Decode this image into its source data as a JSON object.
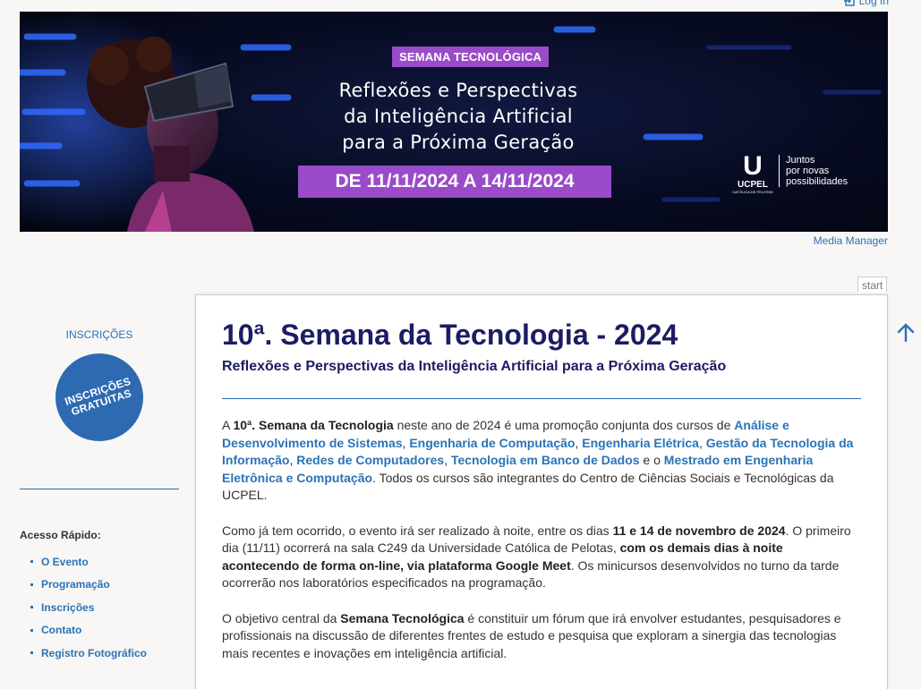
{
  "header": {
    "login_label": "Log In"
  },
  "banner": {
    "tag": "SEMANA TECNOLÓGICA",
    "headline_lines": [
      "Reflexões e Perspectivas",
      "da Inteligência Artificial",
      "para a Próxima Geração"
    ],
    "dates": "DE 11/11/2024 A 14/11/2024",
    "logo_letter": "U",
    "logo_name": "UCPEL",
    "logo_sub": "CATÓLICA DE PELOTAS",
    "slogan_lines": [
      "Juntos",
      "por novas",
      "possibilidades"
    ]
  },
  "media_manager_label": "Media Manager",
  "sidebar": {
    "inscricoes_heading": "INSCRIÇÕES",
    "badge_lines": [
      "INSCRIÇÕES",
      "GRATUITAS"
    ],
    "quick_access_title": "Acesso Rápido:",
    "quick_links": [
      "O Evento",
      "Programação",
      "Inscrições",
      "Contato",
      "Registro Fotográfico"
    ]
  },
  "start_tab_label": "start",
  "content": {
    "title": "10ª. Semana da Tecnologia - 2024",
    "subtitle": "Reflexões e Perspectivas da Inteligência Artificial para a Próxima Geração",
    "p1": {
      "t1": "A ",
      "b1": "10ª. Semana da Tecnologia",
      "t2": " neste ano de 2024 é uma promoção conjunta dos cursos de ",
      "l1": "Análise e Desenvolvimento de Sistemas",
      "t3": ", ",
      "l2": "Engenharia de Computação",
      "t4": ", ",
      "l3": "Engenharia Elétrica",
      "t5": ", ",
      "l4": "Gestão da Tecnologia da Informação",
      "t6": ", ",
      "l5": "Redes de Computadores",
      "t7": ", ",
      "l6": "Tecnologia em Banco de Dados",
      "t8": " e o ",
      "l7": "Mestrado em Engenharia Eletrônica e Computação",
      "t9": ". Todos os cursos são integrantes do Centro de Ciências Sociais e Tecnológicas da UCPEL."
    },
    "p2": {
      "t1": "Como já tem ocorrido, o evento irá ser realizado à noite, entre os dias ",
      "b1": "11 e 14 de novembro de 2024",
      "t2": ". O primeiro dia (11/11) ocorrerá na sala C249 da Universidade Católica de Pelotas, ",
      "b2": "com os demais dias à noite acontecendo de forma on-line, via plataforma Google Meet",
      "t3": ". Os minicursos desenvolvidos no turno da tarde ocorrerão nos laboratórios especificados na programação."
    },
    "p3": {
      "t1": "O objetivo central da ",
      "b1": "Semana Tecnológica",
      "t2": " é constituir um fórum que irá envolver estudantes, pesquisadores e profissionais na discussão de diferentes frentes de estudo e pesquisa que exploram a sinergia das tecnologias mais recentes e inovações em inteligência artificial."
    }
  },
  "colors": {
    "link": "#2b73b7",
    "title": "#1c1c64",
    "accent_purple": "#9a4bc9",
    "badge": "#2d6ab1"
  },
  "icons": {
    "login": "login-icon",
    "back_to_top": "arrow-up-icon"
  }
}
